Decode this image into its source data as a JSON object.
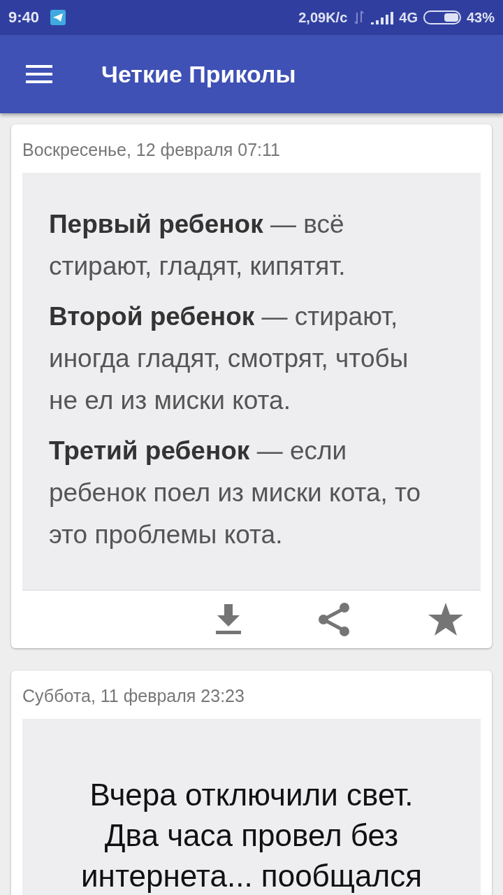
{
  "status_bar": {
    "time": "9:40",
    "speed": "2,09K/с",
    "network": "4G",
    "battery": "43%"
  },
  "app_bar": {
    "title": "Четкие Приколы"
  },
  "posts": [
    {
      "date": "Воскресенье, 12 февраля  07:11",
      "kind": "list",
      "paragraphs": [
        "**Первый ребенок** — всё стирают, гладят, кипятят.",
        "**Второй ребенок** — стирают, иногда гладят, смотрят, чтобы не ел из миски кота.",
        "**Третий ребенок** — если ребенок поел из миски кота, то это проблемы кота."
      ]
    },
    {
      "date": "Суббота, 11 февраля  23:23",
      "kind": "centered",
      "paragraphs": [
        "Вчера отключили свет. Два часа провел без интернета... пообщался"
      ]
    }
  ]
}
